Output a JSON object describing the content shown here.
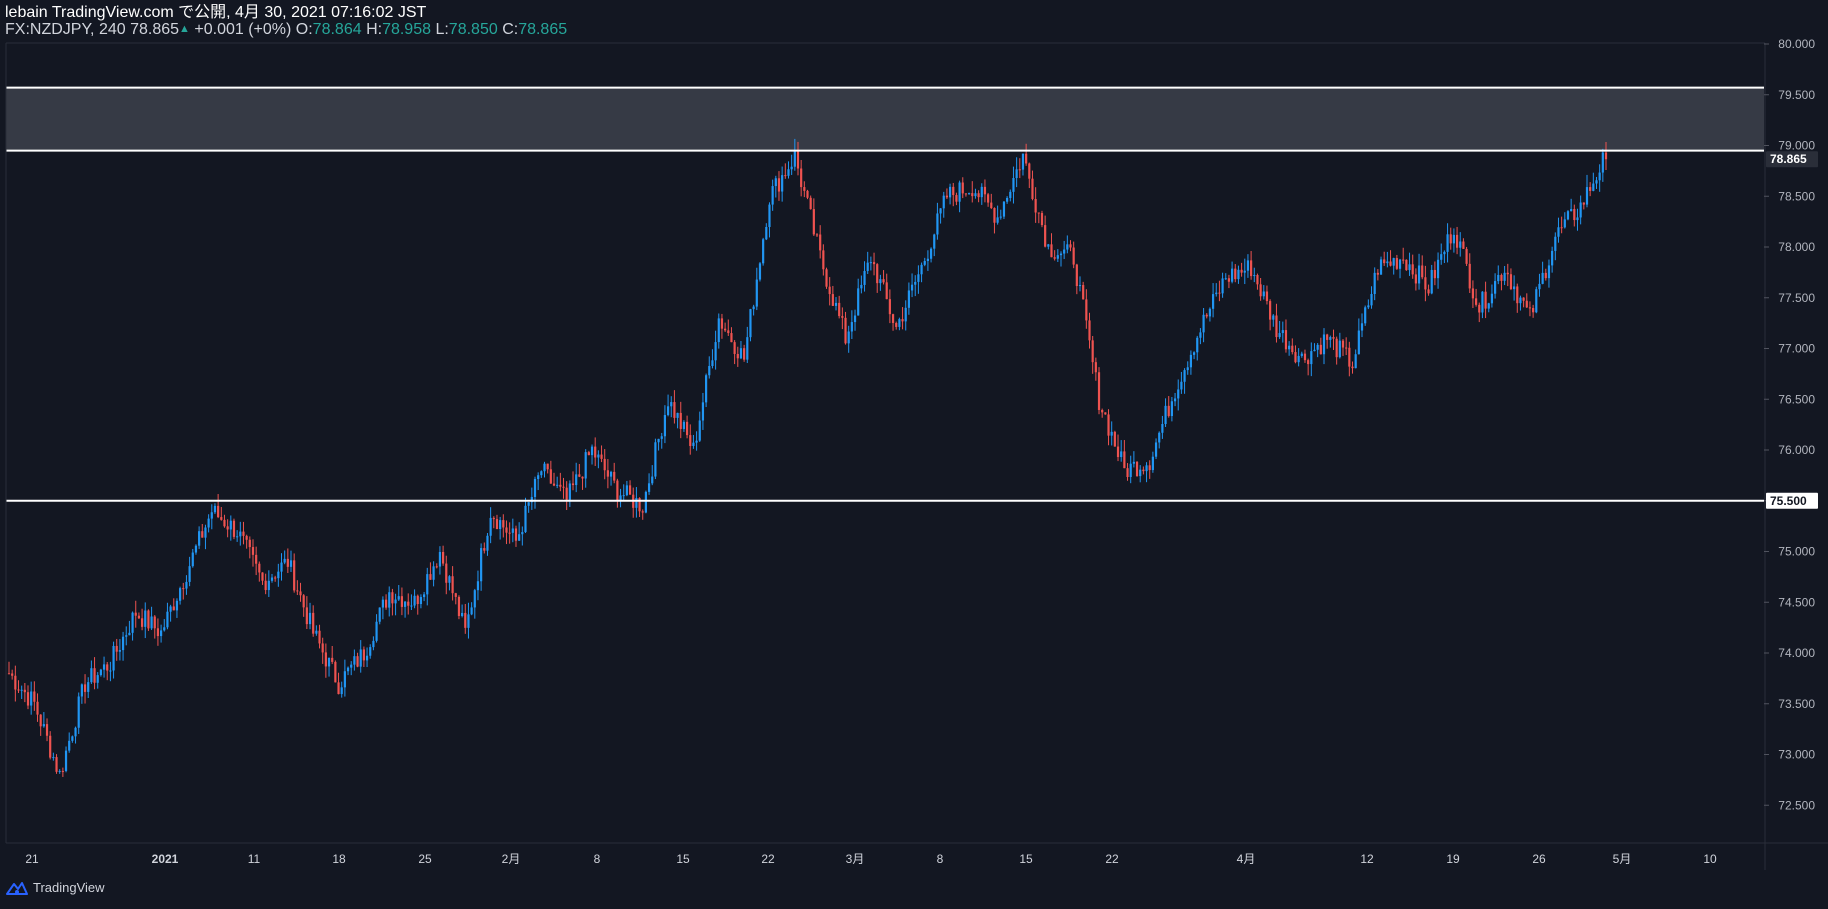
{
  "header": {
    "publish_line": "lebain TradingView.com で公開, 4月 30, 2021 07:16:02 JST",
    "symbol": "FX:NZDJPY, 240",
    "last": "78.865",
    "change": "+0.001 (+0%)",
    "o_label": "O:",
    "o_value": "78.864",
    "h_label": "H:",
    "h_value": "78.958",
    "l_label": "L:",
    "l_value": "78.850",
    "c_label": "C:",
    "c_value": "78.865"
  },
  "footer": {
    "brand": "TradingView"
  },
  "colors": {
    "background": "#131722",
    "up": "#2196f3",
    "down": "#ef5350",
    "grid": "#2a2e39",
    "zone": "#363a45",
    "level": "#ffffff"
  },
  "chart_data": {
    "type": "candlestick",
    "title": "",
    "xlabel": "",
    "ylabel": "",
    "ylim": [
      72.0,
      80.0
    ],
    "y_ticks": [
      "72.500",
      "73.000",
      "73.500",
      "74.000",
      "74.500",
      "75.000",
      "75.500",
      "76.000",
      "76.500",
      "77.000",
      "77.500",
      "78.000",
      "78.500",
      "79.000",
      "79.500",
      "80.000"
    ],
    "x_ticks": [
      "21",
      "2021",
      "11",
      "18",
      "25",
      "2月",
      "8",
      "15",
      "22",
      "3月",
      "8",
      "15",
      "22",
      "4月",
      "12",
      "19",
      "26",
      "5月",
      "10"
    ],
    "grid": false,
    "last_price_label": "78.865",
    "horizontal_lines": [
      {
        "y": 79.57,
        "label": ""
      },
      {
        "y": 78.95,
        "label": ""
      },
      {
        "y": 75.5,
        "label": "75.500"
      }
    ],
    "zones": [
      {
        "y_low": 78.95,
        "y_high": 79.57
      }
    ],
    "anchors": [
      [
        "21",
        73.8
      ],
      [
        "",
        73.5
      ],
      [
        "",
        72.8
      ],
      [
        "",
        73.7
      ],
      [
        "",
        73.9
      ],
      [
        "",
        74.4
      ],
      [
        "2021",
        74.2
      ],
      [
        "",
        74.8
      ],
      [
        "",
        75.4
      ],
      [
        "11",
        75.2
      ],
      [
        "",
        74.7
      ],
      [
        "",
        74.9
      ],
      [
        "18",
        74.2
      ],
      [
        "",
        73.7
      ],
      [
        "",
        74.0
      ],
      [
        "",
        74.6
      ],
      [
        "25",
        74.5
      ],
      [
        "",
        75.0
      ],
      [
        "",
        74.2
      ],
      [
        "2月",
        75.4
      ],
      [
        "",
        75.1
      ],
      [
        "",
        75.8
      ],
      [
        "8",
        75.5
      ],
      [
        "",
        76.0
      ],
      [
        "",
        75.6
      ],
      [
        "15",
        75.45
      ],
      [
        "",
        76.5
      ],
      [
        "",
        76.0
      ],
      [
        "22",
        77.3
      ],
      [
        "",
        76.9
      ],
      [
        "",
        78.5
      ],
      [
        "",
        78.9
      ],
      [
        "",
        77.9
      ],
      [
        "3月",
        77.1
      ],
      [
        "",
        77.9
      ],
      [
        "",
        77.2
      ],
      [
        "8",
        77.8
      ],
      [
        "",
        78.5
      ],
      [
        "15",
        78.6
      ],
      [
        "",
        78.3
      ],
      [
        "",
        78.9
      ],
      [
        "",
        78.0
      ],
      [
        "22",
        77.9
      ],
      [
        "",
        76.5
      ],
      [
        "",
        75.8
      ],
      [
        "",
        75.9
      ],
      [
        "",
        76.6
      ],
      [
        "4月",
        77.2
      ],
      [
        "",
        77.7
      ],
      [
        "",
        77.8
      ],
      [
        "",
        77.2
      ],
      [
        "",
        76.9
      ],
      [
        "12",
        77.1
      ],
      [
        "",
        76.85
      ],
      [
        "",
        77.8
      ],
      [
        "19",
        77.9
      ],
      [
        "",
        77.6
      ],
      [
        "",
        78.2
      ],
      [
        "",
        77.4
      ],
      [
        "",
        77.8
      ],
      [
        "26",
        77.3
      ],
      [
        "",
        78.1
      ],
      [
        "",
        78.4
      ],
      [
        "",
        78.9
      ]
    ]
  }
}
